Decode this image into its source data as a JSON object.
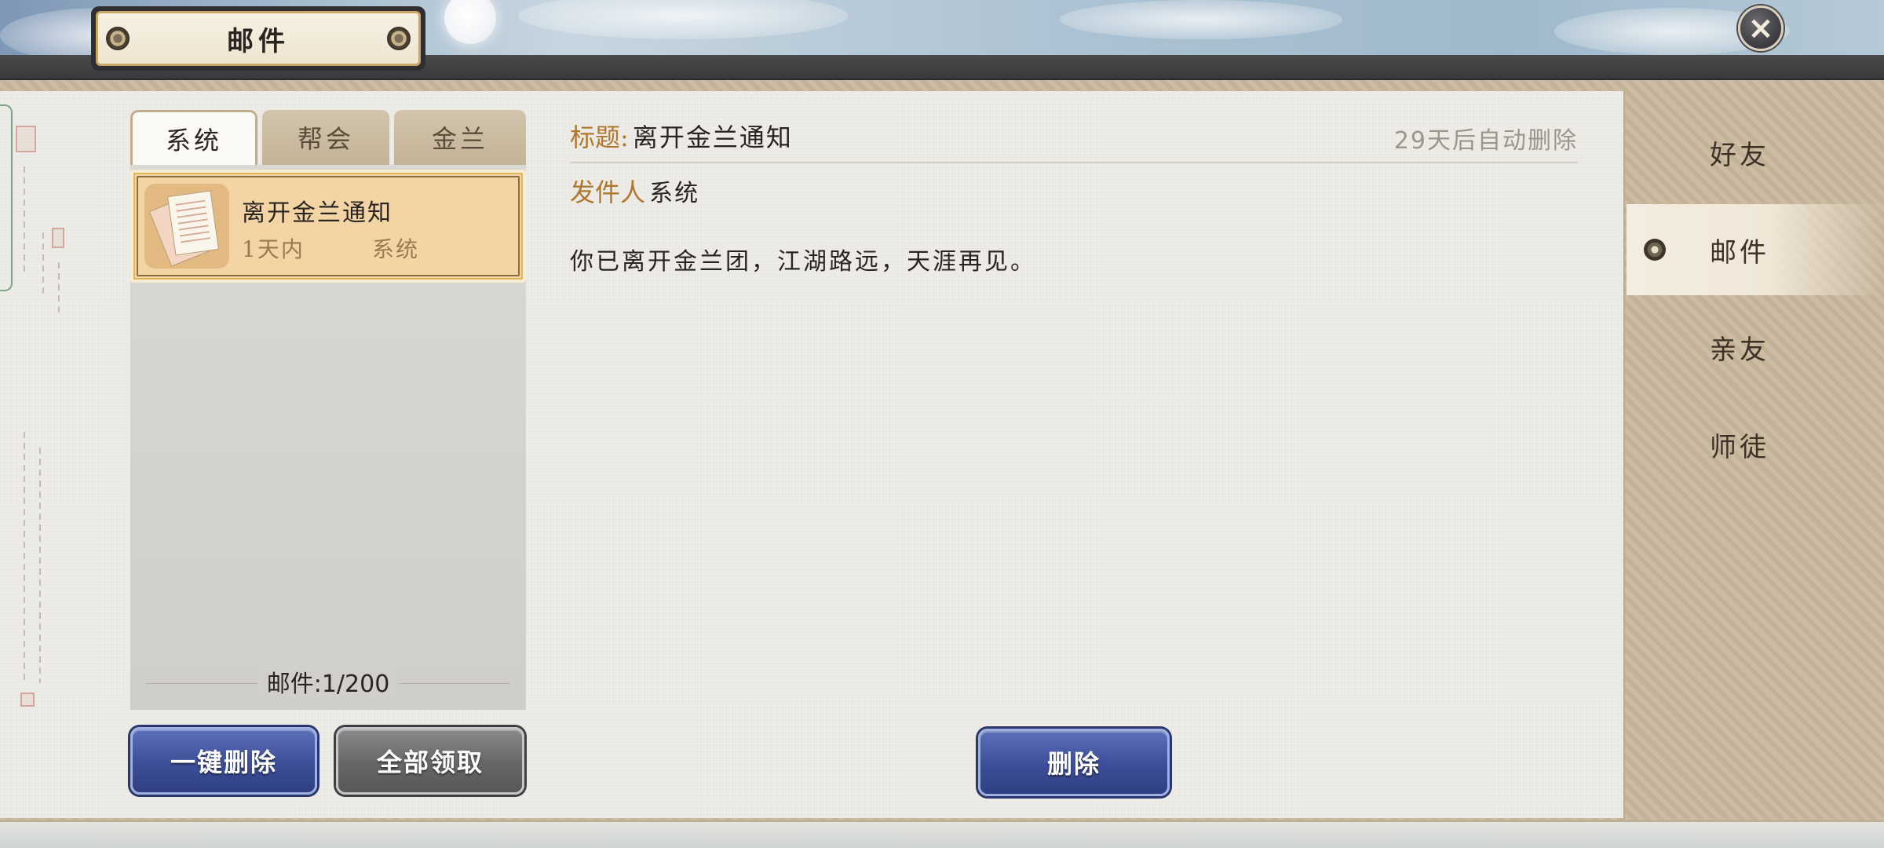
{
  "header": {
    "title": "邮件",
    "close_icon": "close-icon"
  },
  "tabs": [
    {
      "label": "系统",
      "active": true
    },
    {
      "label": "帮会",
      "active": false
    },
    {
      "label": "金兰",
      "active": false
    }
  ],
  "mail_list": {
    "items": [
      {
        "subject": "离开金兰通知",
        "time": "1天内",
        "sender": "系统",
        "icon": "letter-icon",
        "selected": true
      }
    ],
    "count_label": "邮件:1/200"
  },
  "list_buttons": {
    "delete_all": "一键删除",
    "claim_all": "全部领取"
  },
  "detail": {
    "title_label": "标题:",
    "title_value": "离开金兰通知",
    "auto_delete": "29天后自动删除",
    "sender_label": "发件人",
    "sender_value": "系统",
    "body": "你已离开金兰团，江湖路远，天涯再见。",
    "delete_button": "删除"
  },
  "right_nav": [
    {
      "label": "好友",
      "active": false
    },
    {
      "label": "邮件",
      "active": true
    },
    {
      "label": "亲友",
      "active": false
    },
    {
      "label": "师徒",
      "active": false
    }
  ],
  "colors": {
    "accent_gold": "#b0782e",
    "selected_item": "#f3d4a5",
    "button_blue": "#3c4e98",
    "button_gray": "#666668"
  }
}
